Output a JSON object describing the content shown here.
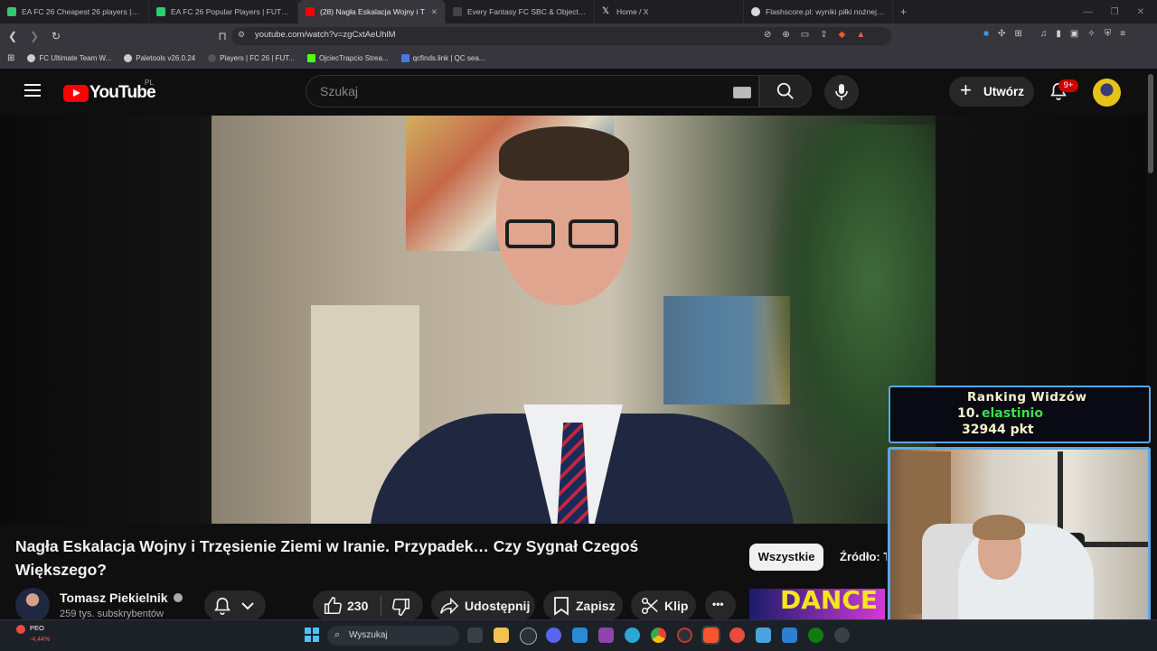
{
  "browser": {
    "tabs": [
      {
        "title": "EA FC 26 Cheapest 26 players | FUTBIN",
        "color": "#2ecc71",
        "active": false
      },
      {
        "title": "EA FC 26 Popular Players | FUTBIN",
        "color": "#2ecc71",
        "active": false
      },
      {
        "title": "(28) Nagła Eskalacja Wojny i T",
        "color": "#ff0000",
        "active": true
      },
      {
        "title": "Every Fantasy FC SBC & Objective Pl",
        "color": "#444444",
        "active": false
      },
      {
        "title": "Home / X",
        "color": "#ffffff",
        "active": false
      },
      {
        "title": "Flashscore.pl: wyniki piłki nożnej, wy",
        "color": "#d9d9d9",
        "active": false
      }
    ],
    "url": "youtube.com/watch?v=zgCxtAeUhlM",
    "bookmarks": [
      {
        "label": "FC Ultimate Team W...",
        "color": "#cccccc"
      },
      {
        "label": "Paletools v26.0.24",
        "color": "#cccccc"
      },
      {
        "label": "Players | FC 26 | FUT...",
        "color": "#555555"
      },
      {
        "label": "OjciecTrapcio Strea...",
        "color": "#53fc18"
      },
      {
        "label": "qcfinds.link | QC sea...",
        "color": "#4a7bd8"
      }
    ]
  },
  "youtube": {
    "logo_text": "YouTube",
    "country_code": "PL",
    "search_placeholder": "Szukaj",
    "create_label": "Utwórz",
    "notifications_badge": "9+"
  },
  "video": {
    "title": "Nagła Eskalacja Wojny i Trzęsienie Ziemi w Iranie. Przypadek… Czy Sygnał Czegoś Większego?",
    "channel_name": "Tomasz Piekielnik",
    "subscribers": "259 tys. subskrybentów",
    "likes": "230",
    "share_label": "Udostępnij",
    "save_label": "Zapisz",
    "clip_label": "Klip",
    "more_label": "•••"
  },
  "chips": {
    "all": "Wszystkie",
    "source": "Źródło: T"
  },
  "related_thumb_text": "DANCE H",
  "overlay": {
    "title": "Ranking Widzów",
    "position": "10.",
    "name": "elastinio",
    "points": "32944 pkt"
  },
  "taskbar": {
    "stock_name": "PEO",
    "stock_change": "-4,44%",
    "search_label": "Wyszukaj"
  },
  "colors": {
    "youtube_red": "#ff0000",
    "overlay_border": "#5aa8e8",
    "overlay_name": "#39e04a"
  }
}
